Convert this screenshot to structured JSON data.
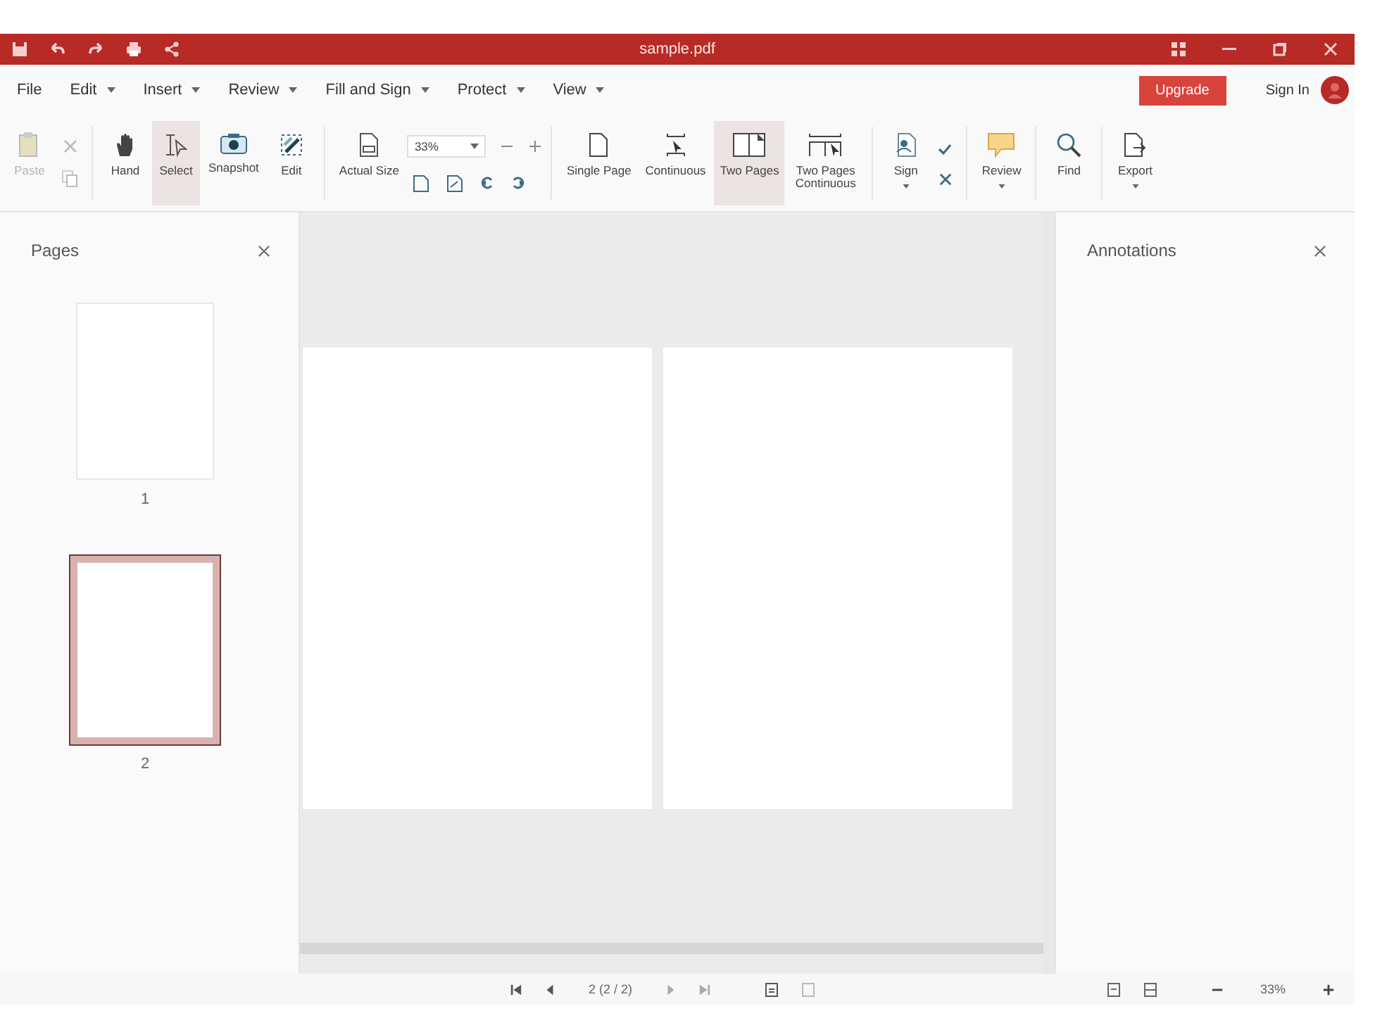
{
  "window": {
    "title": "sample.pdf"
  },
  "menu": [
    {
      "label": "File",
      "dropdown": false
    },
    {
      "label": "Edit",
      "dropdown": true
    },
    {
      "label": "Insert",
      "dropdown": true
    },
    {
      "label": "Review",
      "dropdown": true
    },
    {
      "label": "Fill and Sign",
      "dropdown": true
    },
    {
      "label": "Protect",
      "dropdown": true
    },
    {
      "label": "View",
      "dropdown": true
    }
  ],
  "account": {
    "upgrade": "Upgrade",
    "sign_in": "Sign In"
  },
  "toolbar": {
    "tools": [
      {
        "label": "Paste",
        "disabled": true,
        "selected": false
      },
      {
        "label": "Hand",
        "disabled": false,
        "selected": false
      },
      {
        "label": "Select",
        "disabled": false,
        "selected": true
      },
      {
        "label": "Snapshot",
        "disabled": false,
        "selected": false
      },
      {
        "label": "Edit",
        "disabled": false,
        "selected": false
      }
    ],
    "actual_size": "Actual Size",
    "zoom": "33%",
    "layouts": [
      {
        "label": "Single Page",
        "selected": false
      },
      {
        "label": "Continuous",
        "selected": false
      },
      {
        "label": "Two Pages",
        "selected": true
      },
      {
        "label": "Two Pages Continuous",
        "selected": false
      }
    ],
    "sign": "Sign",
    "review": "Review",
    "find": "Find",
    "export": "Export"
  },
  "pages_panel": {
    "title": "Pages",
    "thumbnails": [
      {
        "label": "1",
        "selected": false
      },
      {
        "label": "2",
        "selected": true
      }
    ]
  },
  "annotations_panel": {
    "title": "Annotations"
  },
  "status_bar": {
    "page": "2 (2 / 2)",
    "zoom": "33%"
  }
}
